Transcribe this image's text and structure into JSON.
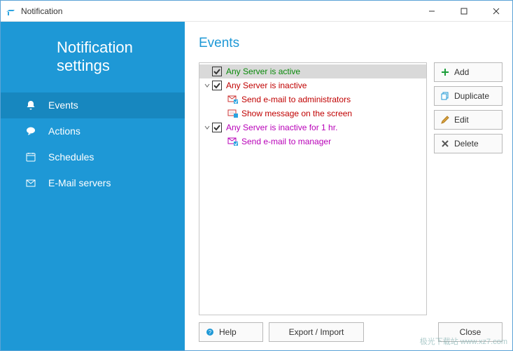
{
  "window": {
    "title": "Notification"
  },
  "sidebar": {
    "header_line1": "Notification",
    "header_line2": "settings",
    "items": [
      {
        "id": "events",
        "label": "Events",
        "icon": "bell-icon",
        "active": true
      },
      {
        "id": "actions",
        "label": "Actions",
        "icon": "bubble-icon",
        "active": false
      },
      {
        "id": "schedules",
        "label": "Schedules",
        "icon": "calendar-icon",
        "active": false
      },
      {
        "id": "email",
        "label": "E-Mail servers",
        "icon": "mail-icon",
        "active": false
      }
    ]
  },
  "main": {
    "title": "Events",
    "tree": [
      {
        "kind": "event",
        "checked": true,
        "selected": true,
        "expanded": null,
        "color": "green",
        "label": "Any Server is active"
      },
      {
        "kind": "event",
        "checked": true,
        "selected": false,
        "expanded": true,
        "color": "red",
        "label": "Any Server is inactive"
      },
      {
        "kind": "action",
        "icon": "mail",
        "color": "red",
        "label": "Send e-mail to administrators"
      },
      {
        "kind": "action",
        "icon": "screen",
        "color": "red",
        "label": "Show message on the screen"
      },
      {
        "kind": "event",
        "checked": true,
        "selected": false,
        "expanded": true,
        "color": "magenta",
        "label": "Any Server is inactive for 1 hr."
      },
      {
        "kind": "action",
        "icon": "mail",
        "color": "magenta",
        "label": "Send e-mail to manager"
      }
    ],
    "buttons": {
      "add": "Add",
      "duplicate": "Duplicate",
      "edit": "Edit",
      "delete": "Delete"
    },
    "footer": {
      "help": "Help",
      "export": "Export / Import",
      "close": "Close"
    }
  },
  "watermark": "极光下载站 www.xz7.com"
}
